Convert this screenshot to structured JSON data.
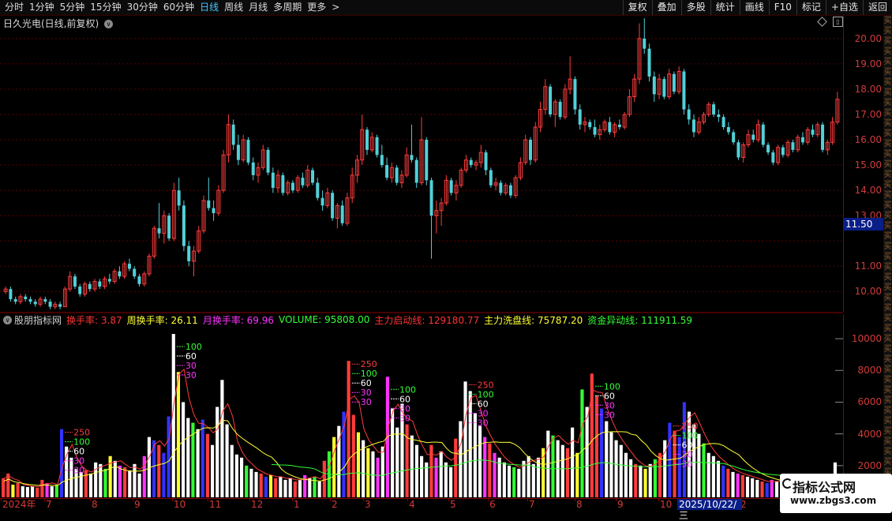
{
  "toolbar": {
    "periods": [
      {
        "label": "分时",
        "active": false
      },
      {
        "label": "1分钟",
        "active": false
      },
      {
        "label": "5分钟",
        "active": false
      },
      {
        "label": "15分钟",
        "active": false
      },
      {
        "label": "30分钟",
        "active": false
      },
      {
        "label": "60分钟",
        "active": false
      },
      {
        "label": "日线",
        "active": true
      },
      {
        "label": "周线",
        "active": false
      },
      {
        "label": "月线",
        "active": false
      },
      {
        "label": "多周期",
        "active": false
      },
      {
        "label": "更多",
        "active": false
      }
    ],
    "more_arrow": ">",
    "right_buttons": [
      "复权",
      "叠加",
      "多股",
      "统计",
      "画线",
      "F10",
      "标记",
      "+自选",
      "返回"
    ]
  },
  "stock": {
    "title": "日久光电(日线,前复权)",
    "chevron": "∨"
  },
  "price_axis": {
    "ticks": [
      "20.00",
      "19.00",
      "18.00",
      "17.00",
      "16.00",
      "15.00",
      "14.00",
      "13.00",
      "11.00",
      "10.00"
    ],
    "current": "11.50"
  },
  "volume_axis": {
    "ticks": [
      "10000",
      "8000",
      "6000",
      "4000",
      "2000"
    ]
  },
  "indicator": {
    "name": "股朋指标网",
    "items": [
      {
        "label": "换手率: 3.87",
        "color": "#ff3333"
      },
      {
        "label": "周换手率: 26.11",
        "color": "#ffff33"
      },
      {
        "label": "月换手率: 69.96",
        "color": "#ff33ff"
      },
      {
        "label": "VOLUME: 95808.00",
        "color": "#33ff33"
      },
      {
        "label": "主力启动线: 129180.77",
        "color": "#ff3333"
      },
      {
        "label": "主力洗盘线: 75787.20",
        "color": "#ffff33"
      },
      {
        "label": "资金异动线: 111911.59",
        "color": "#33ff33"
      }
    ],
    "markers": [
      "250",
      "100",
      "60",
      "30",
      "30"
    ]
  },
  "date_axis": {
    "ticks": [
      "2024年",
      "7",
      "8",
      "9",
      "10",
      "11",
      "12",
      "1",
      "2",
      "3",
      "4",
      "5",
      "6",
      "7",
      "8",
      "9",
      "10",
      "2"
    ],
    "highlight": "2025/10/22/三"
  },
  "right_strip": {
    "chars": "买买买买买买买买买买买买买买买买买买买买买买买买买买买买买买买买买买买买买买买买买买买买买"
  },
  "watermark": {
    "line1": "指标公式网",
    "line2": "www.zbgs3.com"
  },
  "colors": {
    "up": "#ff3c3c",
    "down": "#52d0d8",
    "axis": "#8b0000",
    "grid": "#5a0000",
    "turnover": "#ff3333",
    "weekly": "#ffff33",
    "monthly": "#ff33ff",
    "volume": "#33ff33",
    "white": "#ffffff",
    "blue": "#3333ff"
  },
  "chart_data": [
    {
      "type": "candlestick",
      "title": "日久光电(日线,前复权)",
      "ylim": [
        9.2,
        20.9
      ],
      "y_ticks": [
        10,
        11,
        12,
        13,
        14,
        15,
        16,
        17,
        18,
        19,
        20
      ],
      "current_price": 11.5,
      "candles": [
        [
          10.0,
          10.2,
          9.9,
          10.1
        ],
        [
          10.1,
          10.2,
          9.6,
          9.7
        ],
        [
          9.7,
          9.8,
          9.5,
          9.6
        ],
        [
          9.6,
          9.9,
          9.5,
          9.8
        ],
        [
          9.8,
          9.9,
          9.6,
          9.7
        ],
        [
          9.7,
          9.8,
          9.5,
          9.6
        ],
        [
          9.6,
          9.7,
          9.4,
          9.5
        ],
        [
          9.5,
          9.8,
          9.4,
          9.7
        ],
        [
          9.7,
          9.8,
          9.5,
          9.6
        ],
        [
          9.6,
          9.7,
          9.3,
          9.4
        ],
        [
          9.4,
          9.6,
          9.3,
          9.5
        ],
        [
          9.5,
          9.6,
          9.3,
          9.4
        ],
        [
          9.4,
          10.2,
          9.4,
          10.1
        ],
        [
          10.1,
          10.8,
          10.0,
          10.6
        ],
        [
          10.6,
          10.7,
          10.1,
          10.2
        ],
        [
          10.2,
          10.3,
          9.8,
          9.9
        ],
        [
          9.9,
          10.4,
          9.8,
          10.3
        ],
        [
          10.3,
          10.4,
          10.0,
          10.1
        ],
        [
          10.1,
          10.5,
          10.0,
          10.4
        ],
        [
          10.4,
          10.5,
          10.1,
          10.2
        ],
        [
          10.2,
          10.6,
          10.1,
          10.5
        ],
        [
          10.5,
          10.7,
          10.3,
          10.4
        ],
        [
          10.4,
          10.9,
          10.3,
          10.8
        ],
        [
          10.8,
          11.0,
          10.5,
          10.6
        ],
        [
          10.6,
          11.2,
          10.5,
          11.1
        ],
        [
          11.1,
          11.3,
          10.8,
          10.9
        ],
        [
          10.9,
          11.0,
          10.5,
          10.6
        ],
        [
          10.6,
          10.7,
          10.2,
          10.3
        ],
        [
          10.3,
          10.8,
          10.2,
          10.7
        ],
        [
          10.7,
          11.5,
          10.6,
          11.4
        ],
        [
          11.4,
          12.6,
          11.3,
          12.5
        ],
        [
          12.5,
          13.5,
          12.1,
          12.3
        ],
        [
          12.3,
          13.2,
          11.9,
          13.0
        ],
        [
          13.0,
          13.1,
          12.0,
          12.1
        ],
        [
          12.1,
          14.3,
          12.0,
          14.0
        ],
        [
          14.0,
          14.5,
          13.2,
          13.4
        ],
        [
          13.4,
          13.6,
          11.6,
          11.8
        ],
        [
          11.8,
          12.0,
          11.0,
          11.2
        ],
        [
          11.2,
          11.8,
          10.6,
          11.6
        ],
        [
          11.6,
          12.6,
          11.5,
          12.4
        ],
        [
          12.4,
          13.8,
          12.3,
          13.6
        ],
        [
          13.6,
          14.5,
          13.2,
          13.3
        ],
        [
          13.3,
          13.6,
          12.8,
          13.1
        ],
        [
          13.1,
          14.2,
          13.0,
          14.0
        ],
        [
          14.0,
          15.6,
          13.9,
          15.4
        ],
        [
          15.4,
          17.0,
          15.1,
          16.6
        ],
        [
          16.6,
          16.8,
          15.6,
          15.8
        ],
        [
          15.8,
          16.2,
          15.0,
          15.2
        ],
        [
          15.2,
          16.2,
          15.1,
          16.0
        ],
        [
          16.0,
          16.1,
          15.0,
          15.1
        ],
        [
          15.1,
          15.3,
          14.4,
          14.6
        ],
        [
          14.6,
          15.1,
          14.3,
          14.9
        ],
        [
          14.9,
          15.8,
          14.8,
          15.6
        ],
        [
          15.6,
          15.7,
          14.6,
          14.7
        ],
        [
          14.7,
          14.9,
          13.9,
          14.1
        ],
        [
          14.1,
          14.8,
          13.9,
          14.6
        ],
        [
          14.6,
          14.7,
          13.8,
          13.9
        ],
        [
          13.9,
          14.4,
          13.8,
          14.3
        ],
        [
          14.3,
          14.4,
          13.9,
          14.0
        ],
        [
          14.0,
          14.6,
          13.9,
          14.5
        ],
        [
          14.5,
          14.7,
          14.1,
          14.2
        ],
        [
          14.2,
          15.0,
          14.1,
          14.8
        ],
        [
          14.8,
          14.9,
          14.2,
          14.3
        ],
        [
          14.3,
          14.5,
          13.6,
          13.7
        ],
        [
          13.7,
          14.0,
          13.2,
          13.4
        ],
        [
          13.4,
          14.1,
          13.3,
          13.9
        ],
        [
          13.9,
          14.0,
          12.8,
          12.9
        ],
        [
          12.9,
          13.5,
          12.5,
          13.4
        ],
        [
          13.4,
          13.6,
          12.6,
          12.7
        ],
        [
          12.7,
          13.9,
          12.6,
          13.7
        ],
        [
          13.7,
          14.9,
          13.5,
          14.6
        ],
        [
          14.6,
          15.4,
          14.3,
          15.2
        ],
        [
          15.2,
          17.0,
          15.0,
          16.4
        ],
        [
          16.4,
          16.5,
          15.4,
          15.6
        ],
        [
          15.6,
          16.3,
          15.5,
          16.1
        ],
        [
          16.1,
          16.2,
          15.3,
          15.4
        ],
        [
          15.4,
          15.8,
          14.9,
          15.0
        ],
        [
          15.0,
          15.3,
          14.4,
          14.5
        ],
        [
          14.5,
          15.1,
          14.3,
          14.9
        ],
        [
          14.9,
          15.0,
          14.2,
          14.3
        ],
        [
          14.3,
          14.8,
          14.1,
          14.6
        ],
        [
          14.6,
          15.7,
          14.5,
          15.4
        ],
        [
          15.4,
          16.6,
          15.1,
          15.2
        ],
        [
          15.2,
          15.3,
          14.1,
          14.3
        ],
        [
          14.3,
          16.9,
          14.2,
          16.0
        ],
        [
          16.0,
          16.1,
          14.2,
          14.4
        ],
        [
          14.4,
          14.5,
          11.3,
          13.0
        ],
        [
          13.0,
          13.6,
          12.3,
          13.2
        ],
        [
          13.2,
          13.7,
          12.6,
          13.5
        ],
        [
          13.5,
          14.6,
          13.4,
          14.4
        ],
        [
          14.4,
          14.5,
          13.8,
          13.9
        ],
        [
          13.9,
          14.4,
          13.6,
          14.2
        ],
        [
          14.2,
          14.9,
          14.1,
          14.8
        ],
        [
          14.8,
          15.4,
          14.7,
          15.2
        ],
        [
          15.2,
          15.3,
          14.9,
          15.0
        ],
        [
          15.0,
          15.2,
          14.8,
          15.1
        ],
        [
          15.1,
          15.8,
          14.9,
          15.5
        ],
        [
          15.5,
          15.6,
          14.6,
          14.8
        ],
        [
          14.8,
          14.9,
          14.1,
          14.2
        ],
        [
          14.2,
          14.5,
          14.0,
          14.3
        ],
        [
          14.3,
          14.4,
          13.8,
          13.9
        ],
        [
          13.9,
          14.3,
          13.8,
          14.2
        ],
        [
          14.2,
          14.3,
          13.7,
          13.8
        ],
        [
          13.8,
          14.6,
          13.7,
          14.5
        ],
        [
          14.5,
          15.3,
          14.4,
          15.1
        ],
        [
          15.1,
          16.2,
          15.0,
          16.0
        ],
        [
          16.0,
          16.1,
          15.0,
          15.2
        ],
        [
          15.2,
          16.7,
          15.1,
          16.5
        ],
        [
          16.5,
          17.5,
          16.3,
          17.2
        ],
        [
          17.2,
          18.4,
          17.0,
          18.1
        ],
        [
          18.1,
          18.2,
          16.9,
          17.0
        ],
        [
          17.0,
          17.6,
          16.5,
          17.5
        ],
        [
          17.5,
          17.6,
          16.8,
          16.9
        ],
        [
          16.9,
          18.2,
          16.8,
          18.0
        ],
        [
          18.0,
          19.3,
          17.8,
          18.4
        ],
        [
          18.4,
          18.5,
          17.0,
          17.2
        ],
        [
          17.2,
          17.4,
          16.4,
          16.6
        ],
        [
          16.6,
          16.9,
          16.3,
          16.7
        ],
        [
          16.7,
          16.8,
          16.4,
          16.5
        ],
        [
          16.5,
          16.8,
          16.1,
          16.2
        ],
        [
          16.2,
          16.6,
          16.0,
          16.4
        ],
        [
          16.4,
          16.8,
          16.3,
          16.7
        ],
        [
          16.7,
          16.9,
          16.2,
          16.3
        ],
        [
          16.3,
          16.7,
          16.1,
          16.6
        ],
        [
          16.6,
          16.8,
          16.4,
          16.5
        ],
        [
          16.5,
          17.1,
          16.4,
          17.0
        ],
        [
          17.0,
          18.0,
          16.9,
          17.7
        ],
        [
          17.7,
          18.6,
          17.5,
          18.4
        ],
        [
          18.4,
          20.6,
          18.2,
          20.0
        ],
        [
          20.0,
          20.8,
          19.4,
          19.6
        ],
        [
          19.6,
          19.8,
          18.3,
          18.5
        ],
        [
          18.5,
          18.7,
          17.5,
          17.8
        ],
        [
          17.8,
          18.6,
          17.6,
          18.4
        ],
        [
          18.4,
          18.5,
          17.6,
          17.7
        ],
        [
          17.7,
          18.8,
          17.6,
          18.6
        ],
        [
          18.6,
          18.7,
          17.8,
          17.9
        ],
        [
          17.9,
          18.9,
          17.8,
          18.7
        ],
        [
          18.7,
          18.8,
          17.0,
          17.2
        ],
        [
          17.2,
          17.4,
          16.6,
          16.8
        ],
        [
          16.8,
          17.0,
          16.1,
          16.3
        ],
        [
          16.3,
          16.9,
          16.2,
          16.7
        ],
        [
          16.7,
          17.1,
          16.6,
          17.0
        ],
        [
          17.0,
          17.5,
          16.9,
          17.4
        ],
        [
          17.4,
          17.5,
          16.9,
          17.0
        ],
        [
          17.0,
          17.2,
          16.7,
          16.9
        ],
        [
          16.9,
          17.0,
          16.4,
          16.5
        ],
        [
          16.5,
          16.7,
          16.2,
          16.3
        ],
        [
          16.3,
          16.4,
          15.8,
          15.9
        ],
        [
          15.9,
          16.0,
          15.2,
          15.3
        ],
        [
          15.3,
          15.9,
          15.1,
          15.8
        ],
        [
          15.8,
          16.4,
          15.7,
          16.2
        ],
        [
          16.2,
          16.4,
          15.9,
          16.0
        ],
        [
          16.0,
          16.8,
          15.9,
          16.6
        ],
        [
          16.6,
          16.7,
          15.7,
          15.8
        ],
        [
          15.8,
          15.9,
          15.4,
          15.5
        ],
        [
          15.5,
          15.6,
          15.0,
          15.1
        ],
        [
          15.1,
          15.8,
          15.0,
          15.7
        ],
        [
          15.7,
          15.8,
          15.3,
          15.4
        ],
        [
          15.4,
          16.0,
          15.3,
          15.9
        ],
        [
          15.9,
          16.0,
          15.5,
          15.6
        ],
        [
          15.6,
          16.2,
          15.5,
          16.1
        ],
        [
          16.1,
          16.3,
          15.8,
          15.9
        ],
        [
          15.9,
          16.5,
          15.8,
          16.4
        ],
        [
          16.4,
          16.6,
          16.1,
          16.2
        ],
        [
          16.2,
          16.7,
          16.1,
          16.6
        ],
        [
          16.6,
          16.7,
          15.5,
          15.6
        ],
        [
          15.6,
          16.0,
          15.4,
          15.9
        ],
        [
          15.9,
          16.9,
          15.8,
          16.7
        ],
        [
          16.7,
          17.9,
          16.6,
          17.6
        ]
      ]
    },
    {
      "type": "bar",
      "title": "股朋指标网",
      "ylim": [
        0,
        10800
      ],
      "y_ticks": [
        2000,
        4000,
        6000,
        8000,
        10000
      ],
      "volume": [
        1200,
        1500,
        800,
        900,
        700,
        650,
        700,
        600,
        1100,
        900,
        700,
        800,
        4300,
        3200,
        2500,
        1800,
        1600,
        1700,
        1500,
        2200,
        2100,
        1800,
        2600,
        2300,
        2000,
        1900,
        1700,
        2100,
        1500,
        2600,
        3800,
        3600,
        3300,
        2800,
        5100,
        10300,
        7900,
        6000,
        5000,
        4700,
        4300,
        4900,
        4000,
        3300,
        5700,
        7400,
        4600,
        3300,
        2700,
        2500,
        2000,
        1800,
        1600,
        1500,
        1300,
        1400,
        1200,
        1300,
        1100,
        1200,
        1000,
        1100,
        1400,
        1200,
        1300,
        1000,
        2300,
        2900,
        3800,
        4500,
        5400,
        8600,
        5200,
        4100,
        3600,
        3100,
        2900,
        2500,
        3200,
        7600,
        5600,
        4400,
        5900,
        4600,
        3900,
        3300,
        2600,
        2200,
        3300,
        2500,
        2900,
        2200,
        1900,
        3700,
        4800,
        7300,
        6700,
        5300,
        4500,
        3800,
        3400,
        2800,
        2500,
        2200,
        2000,
        1900,
        1800,
        2300,
        2600,
        2100,
        2500,
        3100,
        4200,
        3900,
        3600,
        3300,
        3100,
        4400,
        2800,
        6800,
        5700,
        7800,
        6400,
        5600,
        4800,
        4100,
        3600,
        3300,
        2800,
        2400,
        2100,
        2000,
        1800,
        2100,
        2400,
        2800,
        3600,
        4700,
        4200,
        3800,
        6000,
        5400,
        4600,
        4000,
        3400,
        2800,
        2600,
        2300,
        2000,
        1800,
        1600,
        1500,
        1400,
        1300,
        1200,
        1100,
        1000,
        900,
        1100,
        1000,
        900,
        850,
        800,
        750,
        700,
        650,
        600,
        550,
        500,
        500,
        450,
        2200
      ],
      "lines": {
        "主力启动线": "red",
        "主力洗盘线": "yellow",
        "资金异动线": "green"
      }
    }
  ]
}
